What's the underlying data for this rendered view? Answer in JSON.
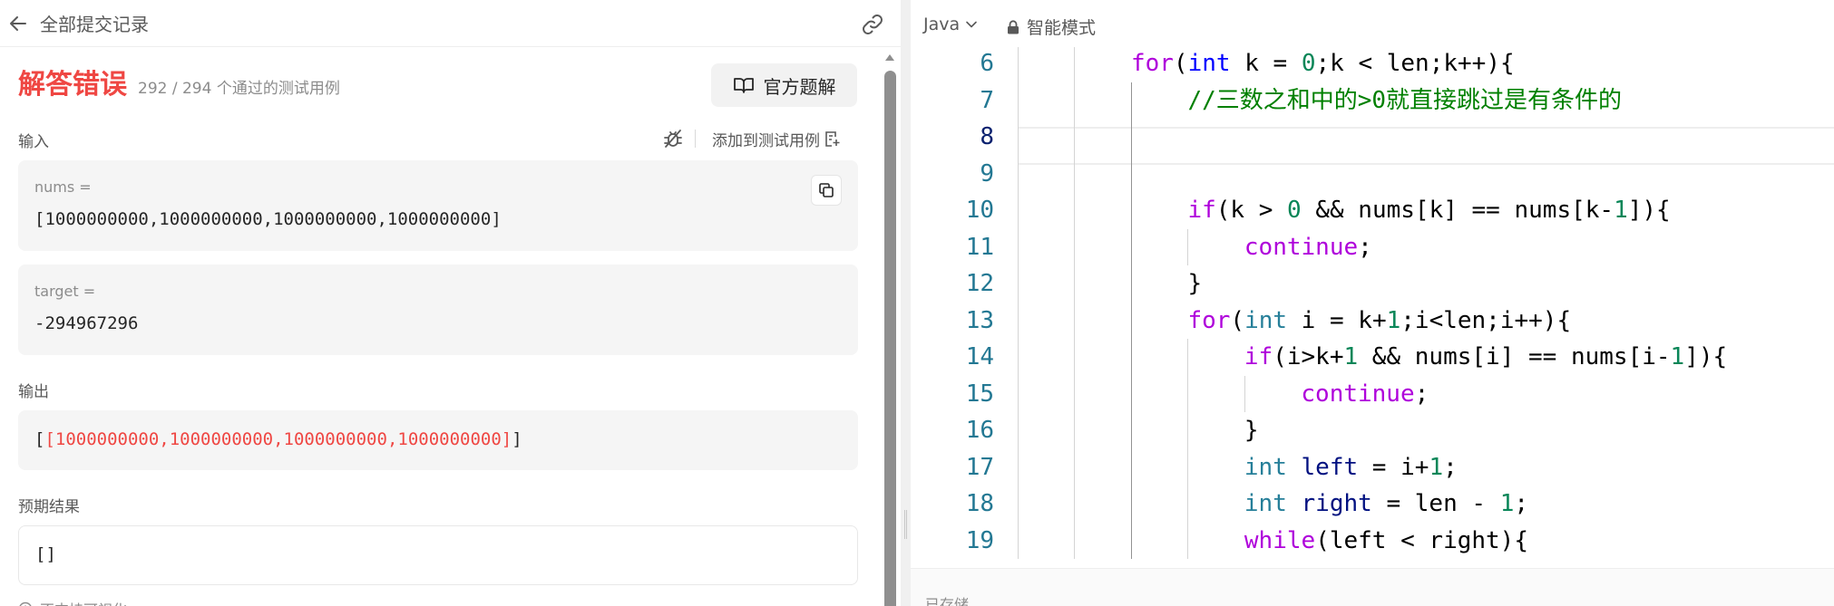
{
  "left": {
    "header_title": "全部提交记录",
    "result_status": "解答错误",
    "result_count": "292 / 294 个通过的测试用例",
    "official_solution": "官方题解",
    "input_label": "输入",
    "add_testcase": "添加到测试用例",
    "inputs": [
      {
        "label": "nums =",
        "value": "[1000000000,1000000000,1000000000,1000000000]"
      },
      {
        "label": "target =",
        "value": "-294967296"
      }
    ],
    "output_label": "输出",
    "output": {
      "open": "[",
      "inner": "[1000000000,1000000000,1000000000,1000000000]",
      "close": "]"
    },
    "expected_label": "预期结果",
    "expected_value": "[]",
    "bottom_note": "不支持可视化",
    "colors": {
      "error": "#ef4743"
    }
  },
  "right": {
    "language": "Java",
    "mode": "智能模式",
    "saved": "已存储",
    "lines": [
      {
        "no": "6",
        "indent": 2,
        "tokens": [
          [
            "kw",
            "for"
          ],
          [
            "",
            "("
          ],
          [
            "tyb",
            "int"
          ],
          [
            "",
            " k = "
          ],
          [
            "num",
            "0"
          ],
          [
            "",
            ";k < len;k++){"
          ]
        ]
      },
      {
        "no": "7",
        "indent": 3,
        "tokens": [
          [
            "cm",
            "//三数之和中的>0就直接跳过是有条件的"
          ]
        ]
      },
      {
        "no": "8",
        "indent": 0,
        "tokens": []
      },
      {
        "no": "9",
        "indent": 0,
        "tokens": []
      },
      {
        "no": "10",
        "indent": 3,
        "tokens": [
          [
            "kw",
            "if"
          ],
          [
            "",
            "(k > "
          ],
          [
            "num",
            "0"
          ],
          [
            "",
            " && nums[k] == nums[k-"
          ],
          [
            "num",
            "1"
          ],
          [
            "",
            "]){"
          ]
        ]
      },
      {
        "no": "11",
        "indent": 4,
        "tokens": [
          [
            "kw",
            "continue"
          ],
          [
            "",
            ";"
          ]
        ]
      },
      {
        "no": "12",
        "indent": 3,
        "tokens": [
          [
            "",
            "}"
          ]
        ]
      },
      {
        "no": "13",
        "indent": 3,
        "tokens": [
          [
            "kw",
            "for"
          ],
          [
            "",
            "("
          ],
          [
            "ty",
            "int"
          ],
          [
            "",
            " i = k+"
          ],
          [
            "num",
            "1"
          ],
          [
            "",
            ";i<len;i++){"
          ]
        ]
      },
      {
        "no": "14",
        "indent": 4,
        "tokens": [
          [
            "kw",
            "if"
          ],
          [
            "",
            "(i>k+"
          ],
          [
            "num",
            "1"
          ],
          [
            "",
            " && nums[i] == nums[i-"
          ],
          [
            "num",
            "1"
          ],
          [
            "",
            "]){"
          ]
        ]
      },
      {
        "no": "15",
        "indent": 5,
        "tokens": [
          [
            "kw",
            "continue"
          ],
          [
            "",
            ";"
          ]
        ]
      },
      {
        "no": "16",
        "indent": 4,
        "tokens": [
          [
            "",
            "}"
          ]
        ]
      },
      {
        "no": "17",
        "indent": 4,
        "tokens": [
          [
            "ty",
            "int"
          ],
          [
            "",
            " "
          ],
          [
            "var",
            "left"
          ],
          [
            "",
            " = i+"
          ],
          [
            "num",
            "1"
          ],
          [
            "",
            ";"
          ]
        ]
      },
      {
        "no": "18",
        "indent": 4,
        "tokens": [
          [
            "ty",
            "int"
          ],
          [
            "",
            " "
          ],
          [
            "var",
            "right"
          ],
          [
            "",
            " = len - "
          ],
          [
            "num",
            "1"
          ],
          [
            "",
            ";"
          ]
        ]
      },
      {
        "no": "19",
        "indent": 4,
        "tokens": [
          [
            "kw",
            "while"
          ],
          [
            "",
            "(left < right){"
          ]
        ]
      }
    ],
    "active_line": "8"
  }
}
